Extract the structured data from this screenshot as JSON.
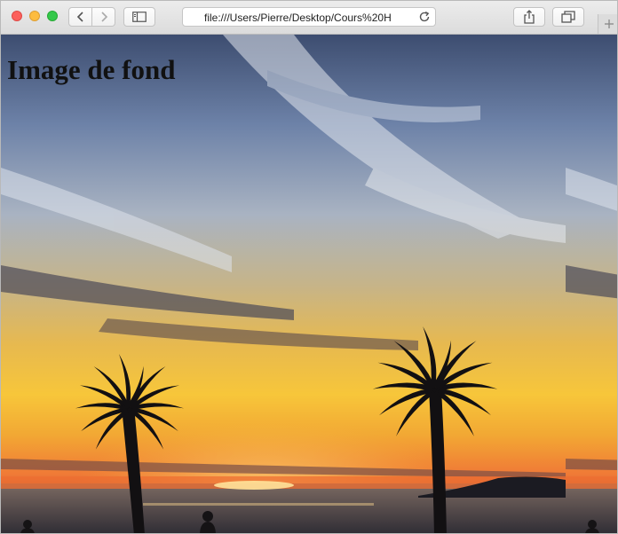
{
  "window": {
    "controls": [
      "close",
      "minimize",
      "zoom"
    ]
  },
  "toolbar": {
    "back_icon": "chevron-left-icon",
    "forward_icon": "chevron-right-icon",
    "sidebar_icon": "sidebar-icon",
    "share_icon": "share-icon",
    "tabs_icon": "tabs-overview-icon",
    "new_tab_icon": "plus-icon"
  },
  "address_bar": {
    "url": "file:///Users/Pierre/Desktop/Cours%20H",
    "reload_icon": "reload-icon"
  },
  "page": {
    "heading": "Image de fond",
    "background_image": "sunset-palm-trees-photo"
  }
}
